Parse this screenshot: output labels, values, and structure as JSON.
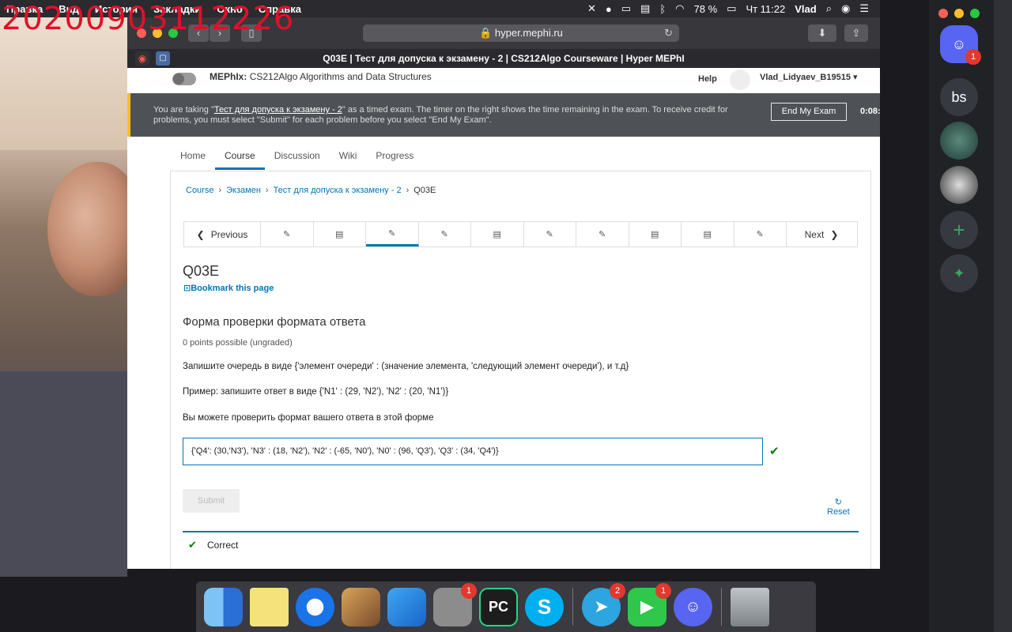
{
  "timestamp_overlay": "20200903112226",
  "menubar": {
    "items": [
      "Правка",
      "Вид",
      "История",
      "Закладки",
      "Окно",
      "Справка"
    ],
    "battery": "78 %",
    "clock": "Чт 11:22",
    "user": "Vlad"
  },
  "browser": {
    "address": "hyper.mephi.ru",
    "tab_title": "Q03E | Тест для допуска к экзамену - 2 | CS212Algo Courseware | Hyper MEPhI"
  },
  "site": {
    "course_prefix": "MEPhIx:",
    "course_name": "CS212Algo Algorithms and Data Structures",
    "help": "Help",
    "username": "Vlad_Lidyaev_B19515"
  },
  "exam_banner": {
    "text_before": "You are taking \"",
    "exam_link": "Тест для допуска к экзамену - 2",
    "text_after": "\" as a timed exam. The timer on the right shows the time remaining in the exam. To receive credit for problems, you must select \"Submit\" for each problem before you select \"End My Exam\".",
    "end_button": "End My Exam",
    "timer": "0:08:"
  },
  "nav_tabs": [
    "Home",
    "Course",
    "Discussion",
    "Wiki",
    "Progress"
  ],
  "breadcrumb": {
    "course": "Course",
    "section": "Экзамен",
    "subsection": "Тест для допуска к экзамену - 2",
    "current": "Q03E"
  },
  "sequence": {
    "previous": "Previous",
    "next": "Next",
    "units": [
      "edit",
      "book",
      "edit",
      "edit",
      "book",
      "edit",
      "edit",
      "book",
      "book",
      "edit"
    ],
    "active_index": 2
  },
  "unit": {
    "title": "Q03E",
    "bookmark": "Bookmark this page"
  },
  "problem": {
    "title": "Форма проверки формата ответа",
    "points": "0 points possible (ungraded)",
    "p1": "Запишите очередь в виде {'элемент очереди' : (значение элемента, 'следующий элемент очереди'), и т.д}",
    "p2": "Пример: запишите ответ в виде {'N1' : (29, 'N2'), 'N2' : (20, 'N1')}",
    "p3": "Вы можете проверить формат вашего ответа в этой форме",
    "answer": "{'Q4': (30,'N3'), 'N3' : (18, 'N2'), 'N2' : (-65, 'N0'), 'N0' : (96, 'Q3'), 'Q3' : (34, 'Q4')}",
    "submit": "Submit",
    "reset": "Reset",
    "result": "Correct"
  },
  "dock": {
    "badges": {
      "system_prefs": "1",
      "telegram": "2",
      "facetime": "1"
    }
  },
  "discord": {
    "badge": "1",
    "server_initials": "bs"
  },
  "colors": {
    "accent": "#0075b4",
    "correct": "#008100",
    "banner": "#4e5257",
    "banner_stripe": "#ffc01f"
  }
}
